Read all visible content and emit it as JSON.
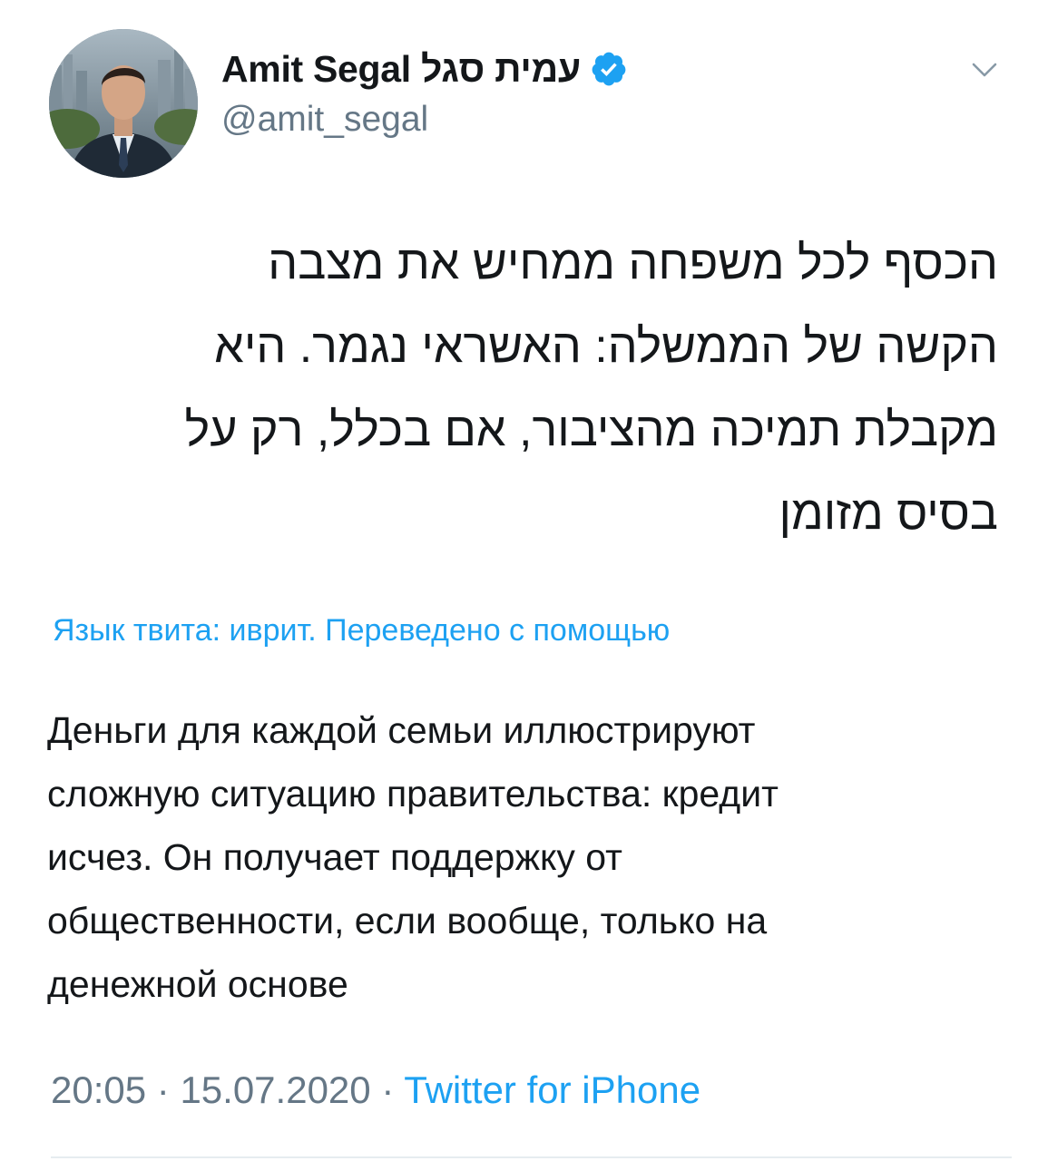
{
  "author": {
    "name": "Amit Segal עמית סגל",
    "handle": "@amit_segal",
    "verified": true,
    "avatar_icon": "profile-photo"
  },
  "tweet": {
    "text_lines": [
      "הכסף לכל משפחה ממחיש את מצבה",
      "הקשה של הממשלה: האשראי נגמר. היא",
      "מקבלת תמיכה מהציבור, אם בכלל, רק על",
      "בסיס מזומן"
    ],
    "translate_link": "Язык твита: иврит. Переведено с помощью",
    "translation_lines": [
      "Деньги для каждой семьи иллюстрируют",
      "сложную ситуацию правительства: кредит",
      "исчез. Он получает поддержку от",
      "общественности, если вообще, только на",
      "денежной основе"
    ],
    "time": "20:05",
    "date": "15.07.2020",
    "separator": " · ",
    "source": "Twitter for iPhone"
  },
  "icons": {
    "verified": "verified-badge-icon",
    "more": "chevron-down-icon"
  },
  "colors": {
    "link": "#1da1f2",
    "secondary_text": "#657786",
    "primary_text": "#14171a",
    "divider": "#e6ecf0"
  }
}
